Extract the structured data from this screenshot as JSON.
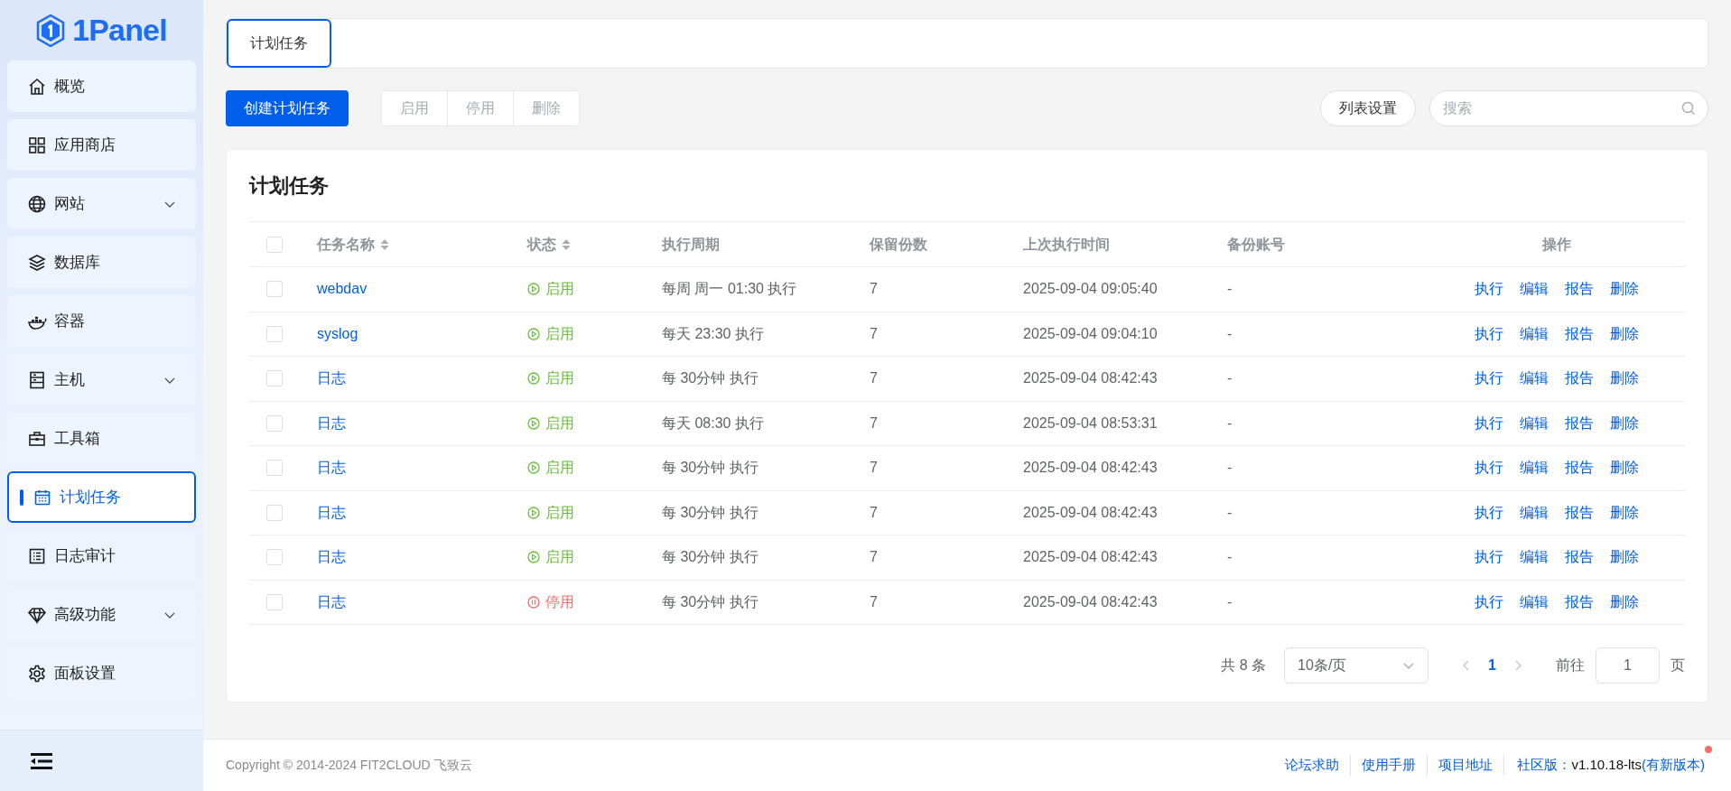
{
  "brand": {
    "name": "1Panel"
  },
  "sidebar": {
    "items": [
      {
        "label": "概览",
        "selected": false,
        "expandable": false
      },
      {
        "label": "应用商店",
        "selected": false,
        "expandable": false
      },
      {
        "label": "网站",
        "selected": false,
        "expandable": true
      },
      {
        "label": "数据库",
        "selected": false,
        "expandable": false
      },
      {
        "label": "容器",
        "selected": false,
        "expandable": false
      },
      {
        "label": "主机",
        "selected": false,
        "expandable": true
      },
      {
        "label": "工具箱",
        "selected": false,
        "expandable": false
      },
      {
        "label": "计划任务",
        "selected": true,
        "expandable": false
      },
      {
        "label": "日志审计",
        "selected": false,
        "expandable": false
      },
      {
        "label": "高级功能",
        "selected": false,
        "expandable": true
      },
      {
        "label": "面板设置",
        "selected": false,
        "expandable": false
      }
    ]
  },
  "tabs": [
    {
      "label": "计划任务",
      "selected": true
    }
  ],
  "toolbar": {
    "create_button": "创建计划任务",
    "batch_buttons": [
      {
        "label": "启用",
        "disabled": true
      },
      {
        "label": "停用",
        "disabled": true
      },
      {
        "label": "删除",
        "disabled": true
      }
    ],
    "column_settings_button": "列表设置",
    "search": {
      "placeholder": "搜索"
    }
  },
  "table": {
    "title": "计划任务",
    "header_checked": false,
    "columns": [
      {
        "label": "任务名称",
        "sortable": true
      },
      {
        "label": "状态",
        "sortable": true
      },
      {
        "label": "执行周期",
        "sortable": false
      },
      {
        "label": "保留份数",
        "sortable": false
      },
      {
        "label": "上次执行时间",
        "sortable": false
      },
      {
        "label": "备份账号",
        "sortable": false
      },
      {
        "label": "操作",
        "sortable": false
      }
    ],
    "rows": [
      {
        "checked": false,
        "name": "webdav",
        "status": {
          "label": "启用",
          "kind": "enabled"
        },
        "schedule": "每周 周一 01:30 执行",
        "retain": "7",
        "last_run": "2025-09-04 09:05:40",
        "backup_account": "-",
        "actions": [
          "执行",
          "编辑",
          "报告",
          "删除"
        ]
      },
      {
        "checked": false,
        "name": "syslog",
        "status": {
          "label": "启用",
          "kind": "enabled"
        },
        "schedule": "每天 23:30 执行",
        "retain": "7",
        "last_run": "2025-09-04 09:04:10",
        "backup_account": "-",
        "actions": [
          "执行",
          "编辑",
          "报告",
          "删除"
        ]
      },
      {
        "checked": false,
        "name": "日志",
        "status": {
          "label": "启用",
          "kind": "enabled"
        },
        "schedule": "每 30分钟 执行",
        "retain": "7",
        "last_run": "2025-09-04 08:42:43",
        "backup_account": "-",
        "actions": [
          "执行",
          "编辑",
          "报告",
          "删除"
        ]
      },
      {
        "checked": false,
        "name": "日志",
        "status": {
          "label": "启用",
          "kind": "enabled"
        },
        "schedule": "每天 08:30 执行",
        "retain": "7",
        "last_run": "2025-09-04 08:53:31",
        "backup_account": "-",
        "actions": [
          "执行",
          "编辑",
          "报告",
          "删除"
        ]
      },
      {
        "checked": false,
        "name": "日志",
        "status": {
          "label": "启用",
          "kind": "enabled"
        },
        "schedule": "每 30分钟 执行",
        "retain": "7",
        "last_run": "2025-09-04 08:42:43",
        "backup_account": "-",
        "actions": [
          "执行",
          "编辑",
          "报告",
          "删除"
        ]
      },
      {
        "checked": false,
        "name": "日志",
        "status": {
          "label": "启用",
          "kind": "enabled"
        },
        "schedule": "每 30分钟 执行",
        "retain": "7",
        "last_run": "2025-09-04 08:42:43",
        "backup_account": "-",
        "actions": [
          "执行",
          "编辑",
          "报告",
          "删除"
        ]
      },
      {
        "checked": false,
        "name": "日志",
        "status": {
          "label": "启用",
          "kind": "enabled"
        },
        "schedule": "每 30分钟 执行",
        "retain": "7",
        "last_run": "2025-09-04 08:42:43",
        "backup_account": "-",
        "actions": [
          "执行",
          "编辑",
          "报告",
          "删除"
        ]
      },
      {
        "checked": false,
        "name": "日志",
        "status": {
          "label": "停用",
          "kind": "disabled"
        },
        "schedule": "每 30分钟 执行",
        "retain": "7",
        "last_run": "2025-09-04 08:42:43",
        "backup_account": "-",
        "actions": [
          "执行",
          "编辑",
          "报告",
          "删除"
        ]
      }
    ]
  },
  "pagination": {
    "total": "共 8 条",
    "page_size": "10条/页",
    "pages": [
      {
        "label": "1",
        "selected": true
      }
    ],
    "goto_label": "前往",
    "goto_value": "1",
    "page_suffix": "页"
  },
  "footer": {
    "copyright": "Copyright © 2014-2024 FIT2CLOUD 飞致云",
    "links": [
      "论坛求助",
      "使用手册",
      "项目地址"
    ],
    "edition_label": "社区版：",
    "version": "v1.10.18-lts",
    "update_link": "(有新版本)",
    "update_badge": true
  }
}
